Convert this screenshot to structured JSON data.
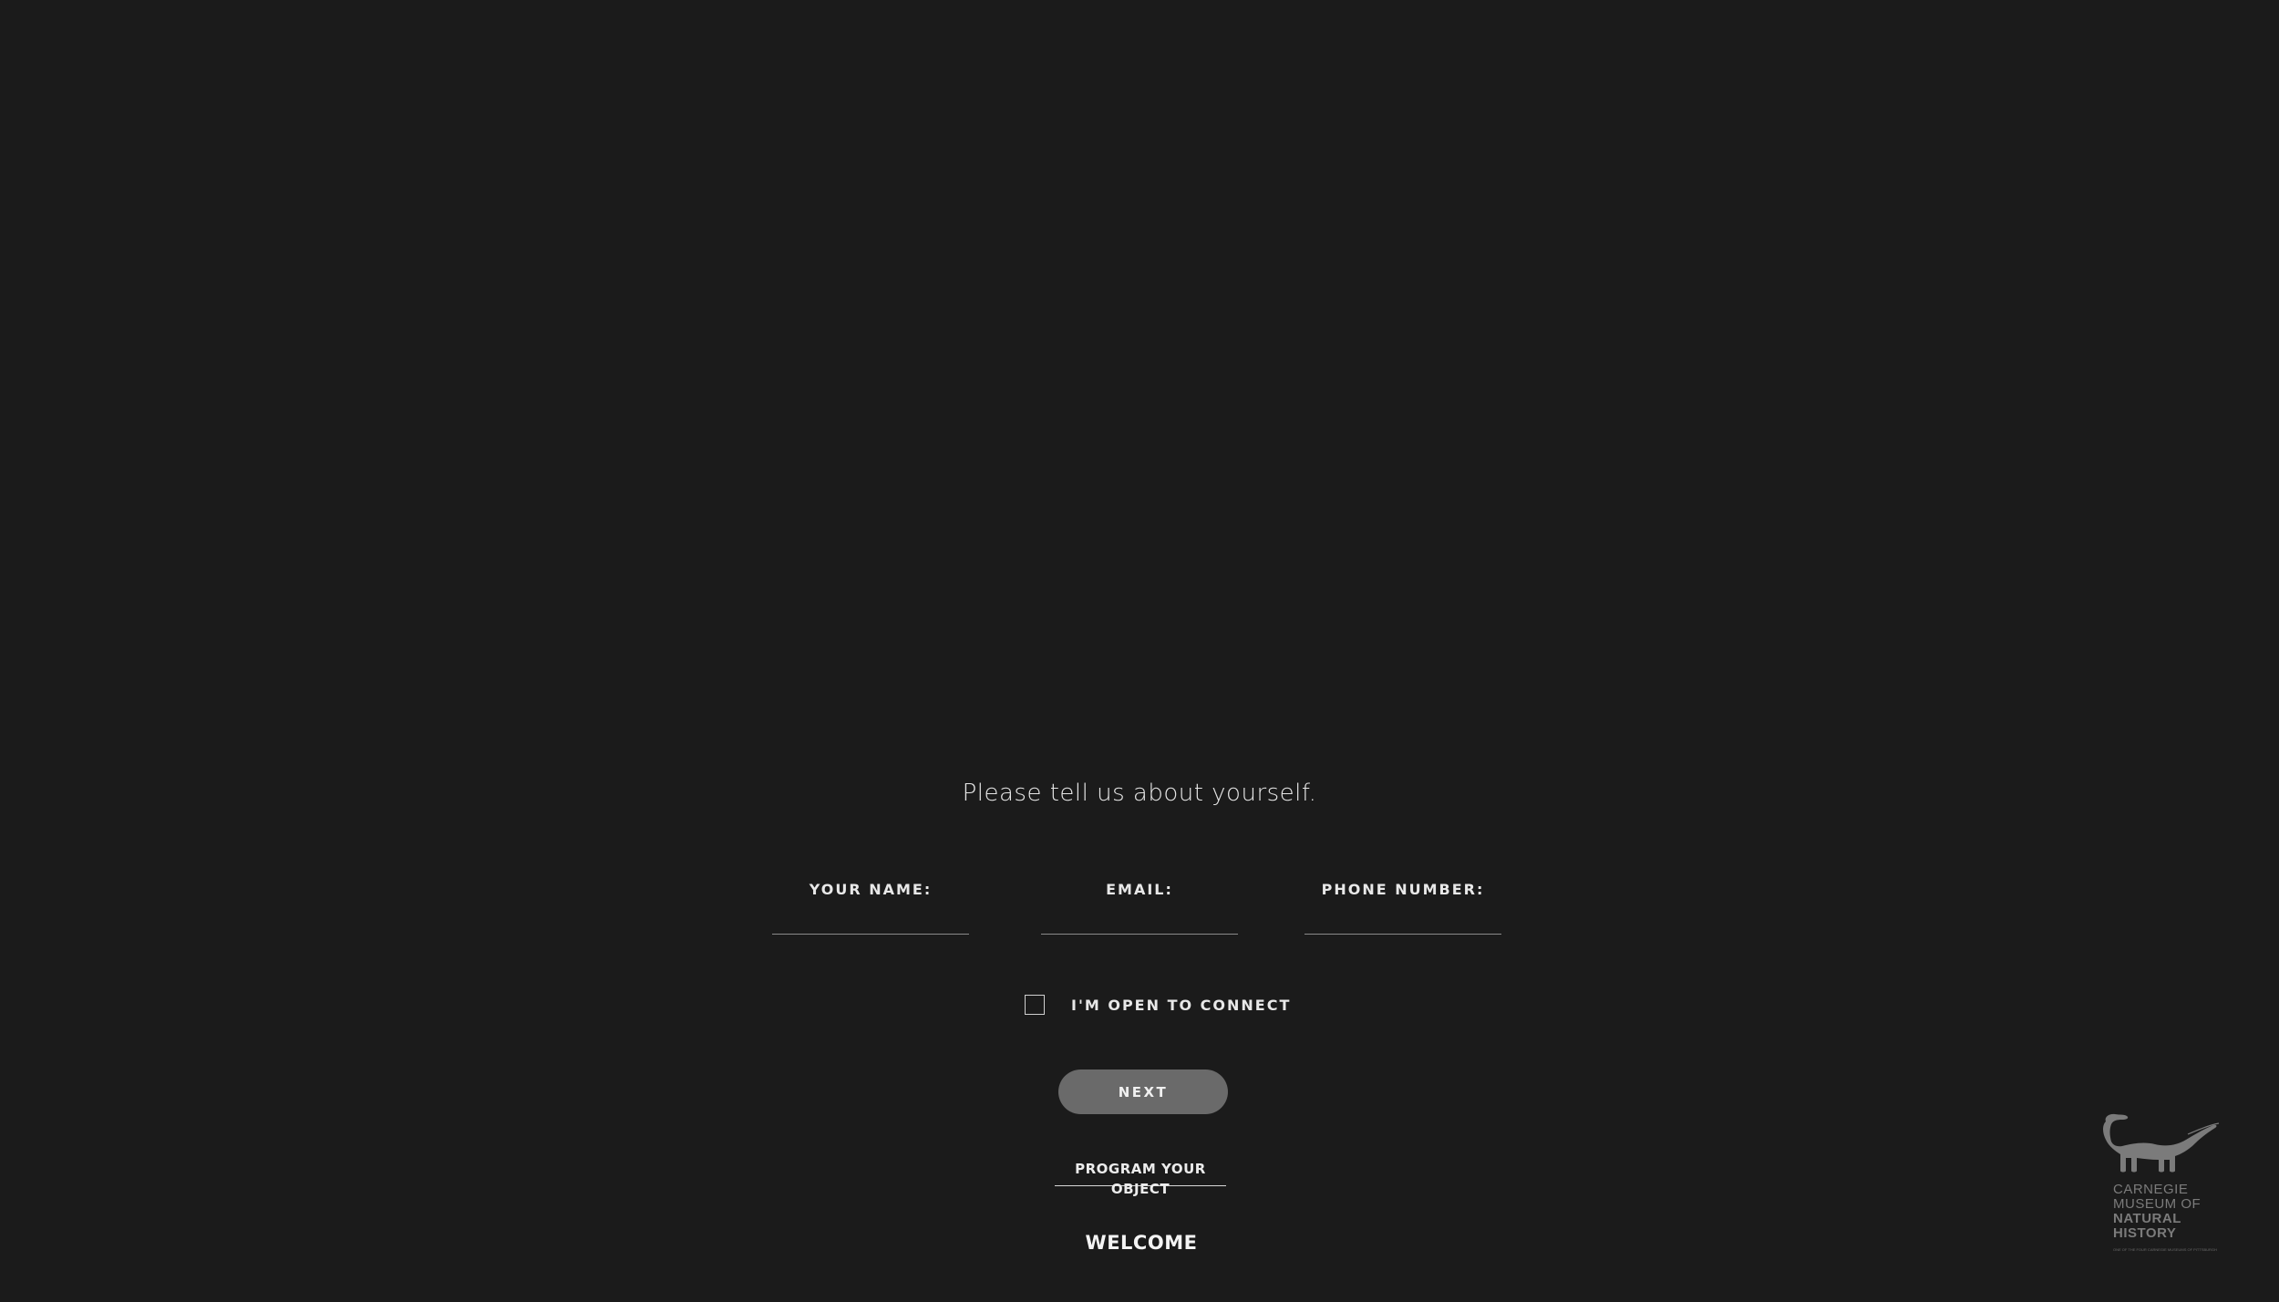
{
  "form": {
    "prompt": "Please tell us about yourself.",
    "fields": {
      "name": {
        "label": "YOUR NAME:",
        "value": ""
      },
      "email": {
        "label": "EMAIL:",
        "value": ""
      },
      "phone": {
        "label": "PHONE NUMBER:",
        "value": ""
      }
    },
    "connect": {
      "label": "I'M OPEN TO CONNECT",
      "checked": false
    },
    "next_label": "NEXT"
  },
  "nav": {
    "program_link": "PROGRAM YOUR OBJECT",
    "welcome": "WELCOME"
  },
  "logo": {
    "line1": "CARNEGIE",
    "line2": "MUSEUM OF",
    "line3": "NATURAL",
    "line4": "HISTORY",
    "tagline": "ONE OF THE FOUR CARNEGIE MUSEUMS OF PITTSBURGH",
    "icon": "dinosaur-icon",
    "color": "#7b7b7b"
  },
  "colors": {
    "background": "#1b1b1b",
    "button": "#6a6a6a",
    "text": "#ececec"
  }
}
